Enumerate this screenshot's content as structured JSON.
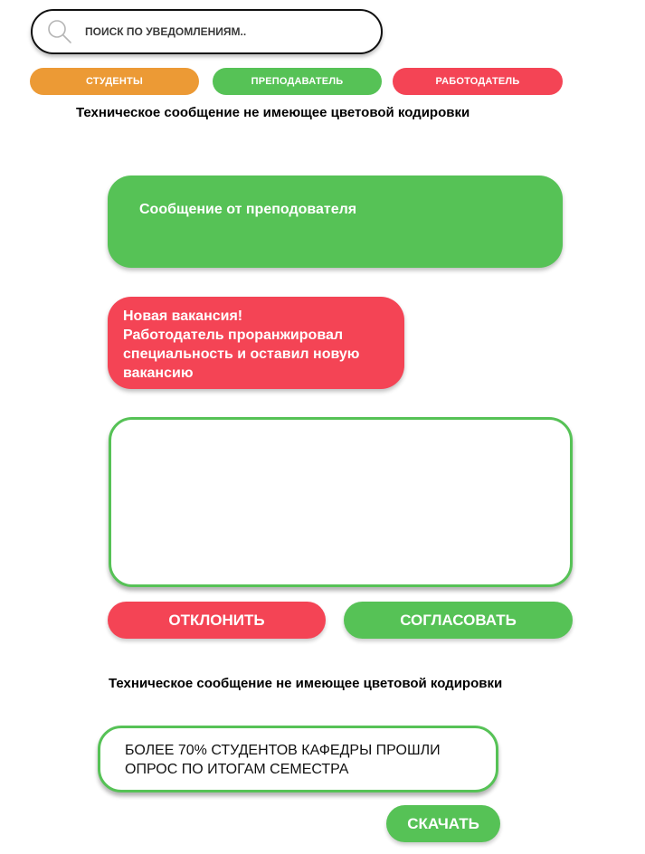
{
  "search": {
    "placeholder": "ПОИСК ПО УВЕДОМЛЕНИЯМ..",
    "value": ""
  },
  "filters": [
    {
      "label": "СТУДЕНТЫ",
      "color": "#ec9a35"
    },
    {
      "label": "ПРЕПОДАВАТЕЛЬ",
      "color": "#56c256"
    },
    {
      "label": "РАБОТОДАТЕЛЬ",
      "color": "#f44455"
    }
  ],
  "notices": {
    "tech_message_1": "Техническое сообщение не имеющее цветовой кодировки",
    "teacher_message": "Сообщение от преподователя",
    "employer_message": {
      "lines": [
        "Новая вакансия!",
        "Работодатель проранжировал",
        "специальность и оставил новую",
        "вакансию"
      ]
    },
    "reply_box_value": "",
    "tech_message_2": "Техническое сообщение не имеющее цветовой кодировки",
    "survey_message": {
      "lines": [
        "БОЛЕЕ 70% СТУДЕНТОВ КАФЕДРЫ ПРОШЛИ",
        "ОПРОС ПО ИТОГАМ СЕМЕСТРА"
      ]
    }
  },
  "actions": {
    "decline_label": "ОТКЛОНИТЬ",
    "approve_label": "СОГЛАСОВАТЬ",
    "download_label": "СКАЧАТЬ"
  },
  "colors": {
    "orange": "#ec9a35",
    "green": "#56c256",
    "red": "#f44455"
  }
}
